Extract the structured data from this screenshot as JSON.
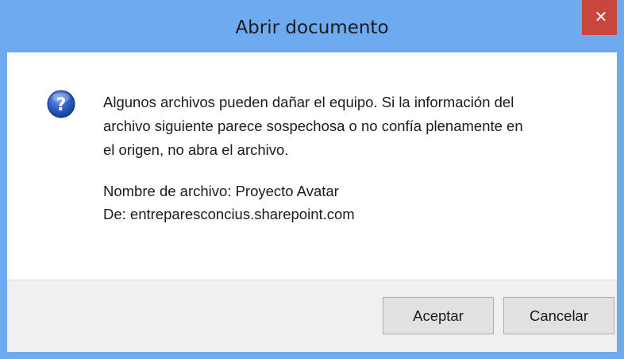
{
  "window": {
    "title": "Abrir documento",
    "close_symbol": "✕"
  },
  "message": {
    "icon": "question-icon",
    "lines": [
      "Algunos archivos pueden dañar el equipo. Si la información del",
      "archivo siguiente parece sospechosa o no confía plenamente en",
      "el origen, no abra el archivo."
    ]
  },
  "details": {
    "file_name": "Nombre de archivo: Proyecto Avatar",
    "from": "De: entreparesconcius.sharepoint.com"
  },
  "buttons": {
    "ok_label": "Aceptar",
    "cancel_label": "Cancelar"
  },
  "colors": {
    "titlebar": "#6eaaf0",
    "close": "#c9463d",
    "footer": "#f0f0f0"
  }
}
